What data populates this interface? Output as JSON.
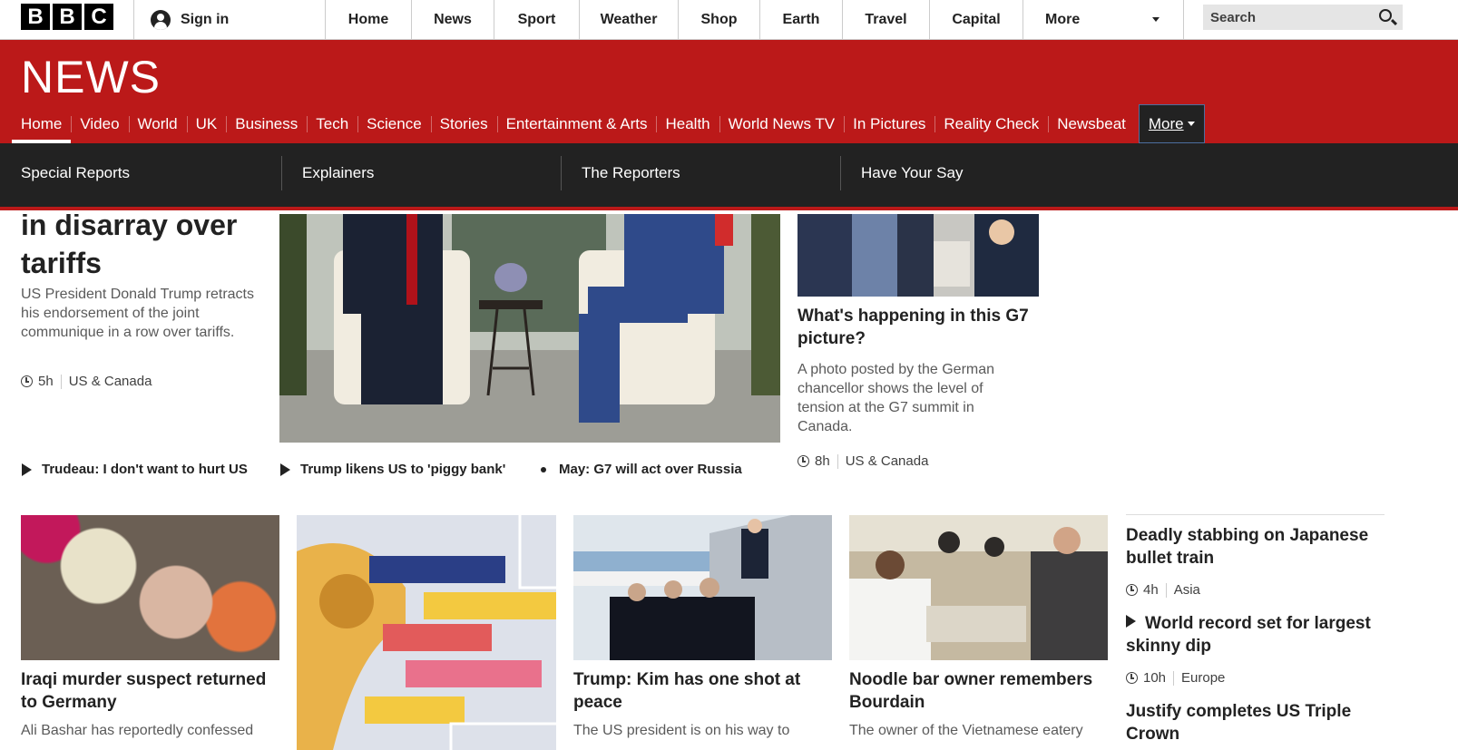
{
  "global_bar": {
    "logo_letters": [
      "B",
      "B",
      "C"
    ],
    "signin_label": "Sign in",
    "nav": [
      {
        "label": "Home"
      },
      {
        "label": "News"
      },
      {
        "label": "Sport"
      },
      {
        "label": "Weather"
      },
      {
        "label": "Shop"
      },
      {
        "label": "Earth"
      },
      {
        "label": "Travel"
      },
      {
        "label": "Capital"
      },
      {
        "label": "More"
      }
    ],
    "search_placeholder": "Search"
  },
  "masthead": {
    "title": "NEWS",
    "nav": [
      {
        "label": "Home"
      },
      {
        "label": "Video"
      },
      {
        "label": "World"
      },
      {
        "label": "UK"
      },
      {
        "label": "Business"
      },
      {
        "label": "Tech"
      },
      {
        "label": "Science"
      },
      {
        "label": "Stories"
      },
      {
        "label": "Entertainment & Arts"
      },
      {
        "label": "Health"
      },
      {
        "label": "World News TV"
      },
      {
        "label": "In Pictures"
      },
      {
        "label": "Reality Check"
      },
      {
        "label": "Newsbeat"
      },
      {
        "label": "More"
      }
    ],
    "active_tab": "Home",
    "secondary": [
      {
        "label": "Special Reports"
      },
      {
        "label": "Explainers"
      },
      {
        "label": "The Reporters"
      },
      {
        "label": "Have Your Say"
      }
    ]
  },
  "lead": {
    "title": "in disarray over tariffs",
    "summary": "US President Donald Trump retracts his endorsement of the joint communique in a row over tariffs.",
    "time": "5h",
    "section": "US & Canada",
    "related": [
      {
        "label": "Trudeau: I don't want to hurt US",
        "icon": "play-icon"
      },
      {
        "label": "Trump likens US to 'piggy bank'",
        "icon": "play-icon"
      },
      {
        "label": "May: G7 will act over Russia",
        "icon": "bullet-icon"
      }
    ]
  },
  "g7_picture": {
    "title": "What's happening in this G7 picture?",
    "summary": "A photo posted by the German chancellor shows the level of tension at the G7 summit in Canada.",
    "time": "8h",
    "section": "US & Canada"
  },
  "stories": [
    {
      "title": "Iraqi murder suspect returned to Germany",
      "summary": "Ali Bashar has reportedly confessed"
    },
    {
      "title": "",
      "summary": ""
    },
    {
      "title": "Trump: Kim has one shot at peace",
      "summary": "The US president is on his way to"
    },
    {
      "title": "Noodle bar owner remembers Bourdain",
      "summary": "The owner of the Vietnamese eatery"
    }
  ],
  "sidebar": [
    {
      "title": "Deadly stabbing on Japanese bullet train",
      "time": "4h",
      "section": "Asia"
    },
    {
      "title": "World record set for largest skinny dip",
      "time": "10h",
      "section": "Europe"
    },
    {
      "title": "Justify completes US Triple Crown"
    }
  ],
  "colors": {
    "news_red": "#bb1919",
    "dark_bar": "#222222"
  }
}
